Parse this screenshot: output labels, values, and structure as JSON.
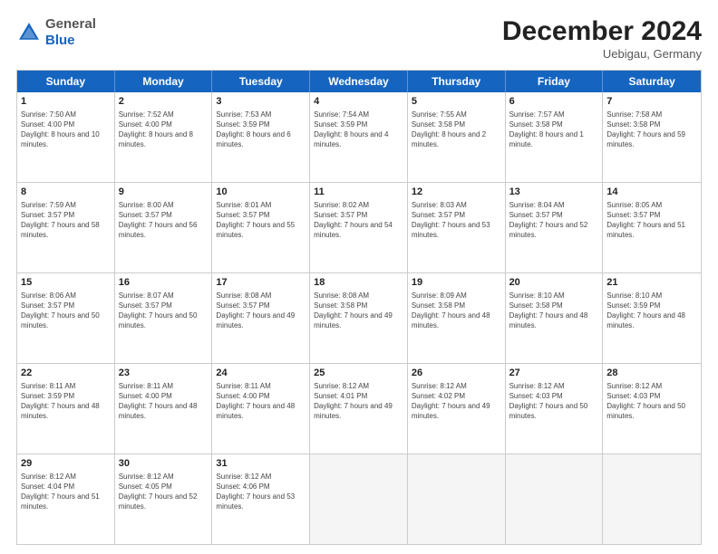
{
  "header": {
    "logo_general": "General",
    "logo_blue": "Blue",
    "month_title": "December 2024",
    "location": "Uebigau, Germany"
  },
  "weekdays": [
    "Sunday",
    "Monday",
    "Tuesday",
    "Wednesday",
    "Thursday",
    "Friday",
    "Saturday"
  ],
  "rows": [
    [
      {
        "day": "1",
        "sunrise": "Sunrise: 7:50 AM",
        "sunset": "Sunset: 4:00 PM",
        "daylight": "Daylight: 8 hours and 10 minutes."
      },
      {
        "day": "2",
        "sunrise": "Sunrise: 7:52 AM",
        "sunset": "Sunset: 4:00 PM",
        "daylight": "Daylight: 8 hours and 8 minutes."
      },
      {
        "day": "3",
        "sunrise": "Sunrise: 7:53 AM",
        "sunset": "Sunset: 3:59 PM",
        "daylight": "Daylight: 8 hours and 6 minutes."
      },
      {
        "day": "4",
        "sunrise": "Sunrise: 7:54 AM",
        "sunset": "Sunset: 3:59 PM",
        "daylight": "Daylight: 8 hours and 4 minutes."
      },
      {
        "day": "5",
        "sunrise": "Sunrise: 7:55 AM",
        "sunset": "Sunset: 3:58 PM",
        "daylight": "Daylight: 8 hours and 2 minutes."
      },
      {
        "day": "6",
        "sunrise": "Sunrise: 7:57 AM",
        "sunset": "Sunset: 3:58 PM",
        "daylight": "Daylight: 8 hours and 1 minute."
      },
      {
        "day": "7",
        "sunrise": "Sunrise: 7:58 AM",
        "sunset": "Sunset: 3:58 PM",
        "daylight": "Daylight: 7 hours and 59 minutes."
      }
    ],
    [
      {
        "day": "8",
        "sunrise": "Sunrise: 7:59 AM",
        "sunset": "Sunset: 3:57 PM",
        "daylight": "Daylight: 7 hours and 58 minutes."
      },
      {
        "day": "9",
        "sunrise": "Sunrise: 8:00 AM",
        "sunset": "Sunset: 3:57 PM",
        "daylight": "Daylight: 7 hours and 56 minutes."
      },
      {
        "day": "10",
        "sunrise": "Sunrise: 8:01 AM",
        "sunset": "Sunset: 3:57 PM",
        "daylight": "Daylight: 7 hours and 55 minutes."
      },
      {
        "day": "11",
        "sunrise": "Sunrise: 8:02 AM",
        "sunset": "Sunset: 3:57 PM",
        "daylight": "Daylight: 7 hours and 54 minutes."
      },
      {
        "day": "12",
        "sunrise": "Sunrise: 8:03 AM",
        "sunset": "Sunset: 3:57 PM",
        "daylight": "Daylight: 7 hours and 53 minutes."
      },
      {
        "day": "13",
        "sunrise": "Sunrise: 8:04 AM",
        "sunset": "Sunset: 3:57 PM",
        "daylight": "Daylight: 7 hours and 52 minutes."
      },
      {
        "day": "14",
        "sunrise": "Sunrise: 8:05 AM",
        "sunset": "Sunset: 3:57 PM",
        "daylight": "Daylight: 7 hours and 51 minutes."
      }
    ],
    [
      {
        "day": "15",
        "sunrise": "Sunrise: 8:06 AM",
        "sunset": "Sunset: 3:57 PM",
        "daylight": "Daylight: 7 hours and 50 minutes."
      },
      {
        "day": "16",
        "sunrise": "Sunrise: 8:07 AM",
        "sunset": "Sunset: 3:57 PM",
        "daylight": "Daylight: 7 hours and 50 minutes."
      },
      {
        "day": "17",
        "sunrise": "Sunrise: 8:08 AM",
        "sunset": "Sunset: 3:57 PM",
        "daylight": "Daylight: 7 hours and 49 minutes."
      },
      {
        "day": "18",
        "sunrise": "Sunrise: 8:08 AM",
        "sunset": "Sunset: 3:58 PM",
        "daylight": "Daylight: 7 hours and 49 minutes."
      },
      {
        "day": "19",
        "sunrise": "Sunrise: 8:09 AM",
        "sunset": "Sunset: 3:58 PM",
        "daylight": "Daylight: 7 hours and 48 minutes."
      },
      {
        "day": "20",
        "sunrise": "Sunrise: 8:10 AM",
        "sunset": "Sunset: 3:58 PM",
        "daylight": "Daylight: 7 hours and 48 minutes."
      },
      {
        "day": "21",
        "sunrise": "Sunrise: 8:10 AM",
        "sunset": "Sunset: 3:59 PM",
        "daylight": "Daylight: 7 hours and 48 minutes."
      }
    ],
    [
      {
        "day": "22",
        "sunrise": "Sunrise: 8:11 AM",
        "sunset": "Sunset: 3:59 PM",
        "daylight": "Daylight: 7 hours and 48 minutes."
      },
      {
        "day": "23",
        "sunrise": "Sunrise: 8:11 AM",
        "sunset": "Sunset: 4:00 PM",
        "daylight": "Daylight: 7 hours and 48 minutes."
      },
      {
        "day": "24",
        "sunrise": "Sunrise: 8:11 AM",
        "sunset": "Sunset: 4:00 PM",
        "daylight": "Daylight: 7 hours and 48 minutes."
      },
      {
        "day": "25",
        "sunrise": "Sunrise: 8:12 AM",
        "sunset": "Sunset: 4:01 PM",
        "daylight": "Daylight: 7 hours and 49 minutes."
      },
      {
        "day": "26",
        "sunrise": "Sunrise: 8:12 AM",
        "sunset": "Sunset: 4:02 PM",
        "daylight": "Daylight: 7 hours and 49 minutes."
      },
      {
        "day": "27",
        "sunrise": "Sunrise: 8:12 AM",
        "sunset": "Sunset: 4:03 PM",
        "daylight": "Daylight: 7 hours and 50 minutes."
      },
      {
        "day": "28",
        "sunrise": "Sunrise: 8:12 AM",
        "sunset": "Sunset: 4:03 PM",
        "daylight": "Daylight: 7 hours and 50 minutes."
      }
    ],
    [
      {
        "day": "29",
        "sunrise": "Sunrise: 8:12 AM",
        "sunset": "Sunset: 4:04 PM",
        "daylight": "Daylight: 7 hours and 51 minutes."
      },
      {
        "day": "30",
        "sunrise": "Sunrise: 8:12 AM",
        "sunset": "Sunset: 4:05 PM",
        "daylight": "Daylight: 7 hours and 52 minutes."
      },
      {
        "day": "31",
        "sunrise": "Sunrise: 8:12 AM",
        "sunset": "Sunset: 4:06 PM",
        "daylight": "Daylight: 7 hours and 53 minutes."
      },
      null,
      null,
      null,
      null
    ]
  ]
}
